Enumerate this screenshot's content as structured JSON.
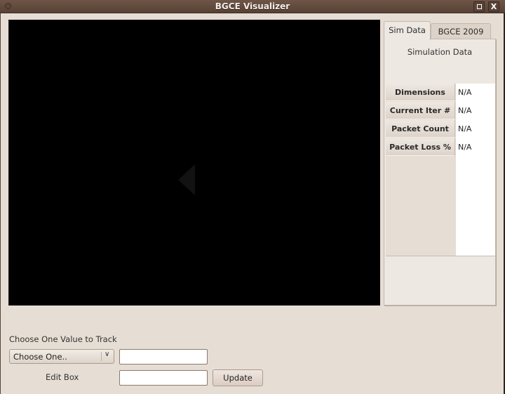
{
  "window": {
    "title": "BGCE Visualizer",
    "controls": {
      "maximize": "maximize",
      "close": "X"
    }
  },
  "tabs": [
    {
      "label": "Sim Data",
      "active": true
    },
    {
      "label": "BGCE 2009",
      "active": false
    }
  ],
  "sim_panel": {
    "heading": "Simulation Data",
    "rows": [
      {
        "label": "Dimensions",
        "value": "N/A"
      },
      {
        "label": "Current Iter #",
        "value": "N/A"
      },
      {
        "label": "Packet Count",
        "value": "N/A"
      },
      {
        "label": "Packet Loss %",
        "value": "N/A"
      }
    ]
  },
  "controls": {
    "track_label": "Choose One Value to Track",
    "combo_selected": "Choose One..",
    "track_value": "",
    "edit_label": "Edit Box",
    "edit_value": "",
    "update_label": "Update"
  }
}
